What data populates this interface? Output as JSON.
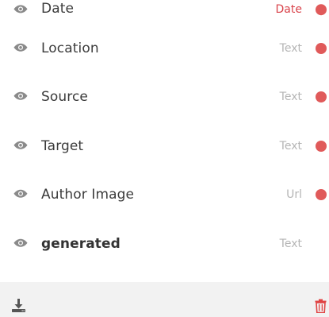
{
  "fields": [
    {
      "name": "Date",
      "type": "Date",
      "type_color": "#d9434b",
      "has_dot": true,
      "bold": false,
      "icon": "eye-icon"
    },
    {
      "name": "Location",
      "type": "Text",
      "has_dot": true,
      "bold": false,
      "icon": "eye-icon"
    },
    {
      "name": "Source",
      "type": "Text",
      "has_dot": true,
      "bold": false,
      "icon": "eye-icon"
    },
    {
      "name": "Target",
      "type": "Text",
      "has_dot": true,
      "bold": false,
      "icon": "eye-icon"
    },
    {
      "name": "Author Image",
      "type": "Url",
      "has_dot": true,
      "bold": false,
      "icon": "eye-icon"
    },
    {
      "name": "generated",
      "type": "Text",
      "has_dot": false,
      "bold": true,
      "icon": "eye-icon"
    }
  ],
  "footer": {
    "download_icon": "download-icon",
    "delete_icon": "trash-icon"
  },
  "colors": {
    "dot": "#e05a5a",
    "accent": "#d9434b",
    "muted_text": "#b5b5b5",
    "footer_bg": "#f2f2f2"
  }
}
